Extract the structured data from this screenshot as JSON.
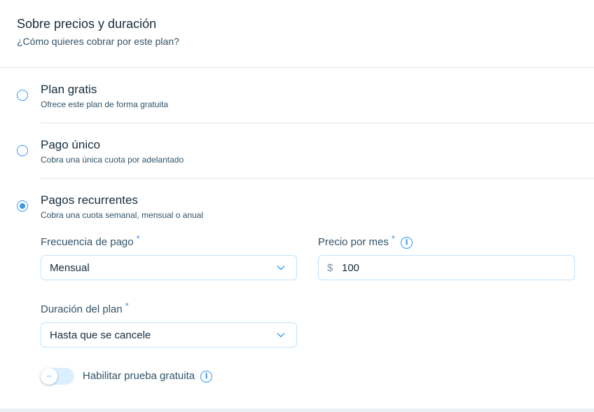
{
  "header": {
    "title": "Sobre precios y duración",
    "subtitle": "¿Cómo quieres cobrar por este plan?"
  },
  "options": [
    {
      "title": "Plan gratis",
      "description": "Ofrece este plan de forma gratuita",
      "selected": false
    },
    {
      "title": "Pago único",
      "description": "Cobra una única cuota por adelantado",
      "selected": false
    },
    {
      "title": "Pagos recurrentes",
      "description": "Cobra una cuota semanal, mensual o anual",
      "selected": true
    }
  ],
  "recurring": {
    "frequency": {
      "label": "Frecuencia de pago",
      "required_mark": "*",
      "value": "Mensual",
      "icon": "chevron-down-icon"
    },
    "price": {
      "label": "Precio por mes",
      "required_mark": "*",
      "info_glyph": "i",
      "currency": "$",
      "value": "100"
    },
    "duration": {
      "label": "Duración del plan",
      "required_mark": "*",
      "value": "Hasta que se cancele",
      "icon": "chevron-down-icon"
    },
    "trial": {
      "label": "Habilitar prueba gratuita",
      "info_glyph": "i",
      "enabled": false
    }
  },
  "colors": {
    "accent": "#3899ec",
    "text_primary": "#162d3d",
    "text_secondary": "#32536a",
    "border": "#c1e4fe",
    "divider": "#dfe5eb"
  }
}
